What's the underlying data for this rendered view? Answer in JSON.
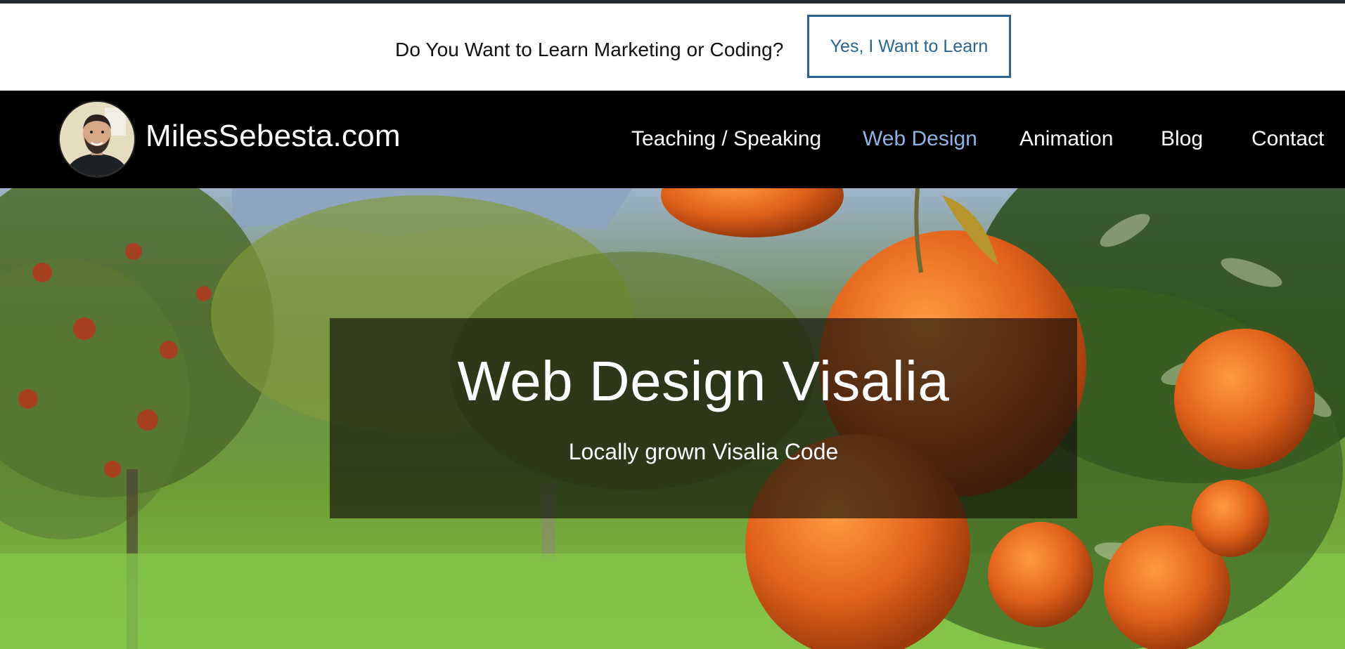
{
  "promo": {
    "text": "Do You Want to Learn Marketing or Coding?",
    "button_label": "Yes, I Want to Learn"
  },
  "header": {
    "brand": "MilesSebesta.com",
    "nav": [
      {
        "label": "Teaching / Speaking",
        "active": false
      },
      {
        "label": "Web Design",
        "active": true
      },
      {
        "label": "Animation",
        "active": false
      },
      {
        "label": "Blog",
        "active": false
      },
      {
        "label": "Contact",
        "active": false
      }
    ]
  },
  "hero": {
    "title": "Web Design Visalia",
    "subtitle": "Locally grown Visalia Code"
  },
  "colors": {
    "accent": "#2b6391",
    "nav_active": "#8fb4e3",
    "header_bg": "#000000"
  }
}
